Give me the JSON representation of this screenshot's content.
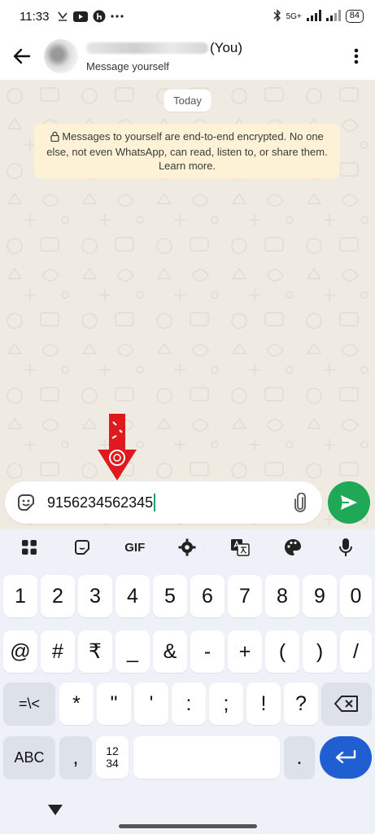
{
  "status_bar": {
    "time": "11:33",
    "network_label": "5G+",
    "battery": "84"
  },
  "header": {
    "contact_suffix": "(You)",
    "subtitle": "Message yourself"
  },
  "chat": {
    "date_chip": "Today",
    "encryption_notice": "Messages to yourself are end-to-end encrypted. No one else, not even WhatsApp, can read, listen to, or share them. Learn more."
  },
  "composer": {
    "input_value": "9156234562345"
  },
  "keyboard": {
    "toolbar": {
      "gif_label": "GIF"
    },
    "row1": [
      "1",
      "2",
      "3",
      "4",
      "5",
      "6",
      "7",
      "8",
      "9",
      "0"
    ],
    "row2": [
      "@",
      "#",
      "₹",
      "_",
      "&",
      "-",
      "+",
      "(",
      ")",
      "/"
    ],
    "row3": {
      "shift_label": "=\\<",
      "keys": [
        "*",
        "\"",
        "'",
        ":",
        ";",
        "!",
        "?"
      ]
    },
    "row4": {
      "abc_label": "ABC",
      "comma": ",",
      "numpad_label_top": "12",
      "numpad_label_bottom": "34",
      "period": "."
    }
  },
  "colors": {
    "accent_green": "#1fa855",
    "chat_bg": "#efeae2",
    "notice_bg": "#fdf2d5",
    "enter_blue": "#1f5fd1",
    "annotation_red": "#e0191f"
  }
}
